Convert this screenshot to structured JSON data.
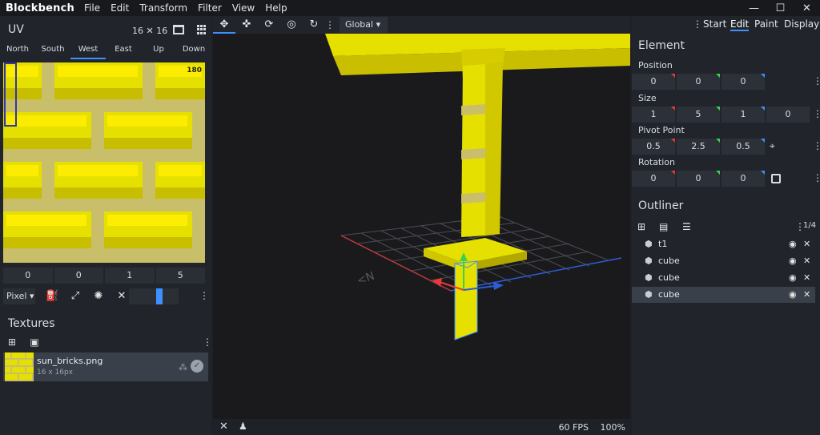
{
  "titlebar": {
    "app_name": "Blockbench",
    "menu": [
      "File",
      "Edit",
      "Transform",
      "Filter",
      "View",
      "Help"
    ],
    "window_controls": [
      "minimize-icon",
      "maximize-icon",
      "close-icon"
    ]
  },
  "uv": {
    "title": "UV",
    "size": "16 ✕ 16",
    "faces": [
      "North",
      "South",
      "West",
      "East",
      "Up",
      "Down"
    ],
    "active_face": "West",
    "rotation": "180",
    "values": [
      "0",
      "0",
      "1",
      "5"
    ],
    "toolbar": {
      "mode": "Pixel"
    }
  },
  "textures": {
    "title": "Textures",
    "items": [
      {
        "name": "sun_bricks.png",
        "dims": "16 x 16px"
      }
    ]
  },
  "viewport": {
    "transform_space": "Global",
    "fps": "60 FPS",
    "zoom": "100%"
  },
  "modes": [
    "Start",
    "Edit",
    "Paint",
    "Display"
  ],
  "active_mode": "Edit",
  "element": {
    "title": "Element",
    "position": {
      "label": "Position",
      "values": [
        "0",
        "0",
        "0"
      ]
    },
    "size": {
      "label": "Size",
      "values": [
        "1",
        "5",
        "1",
        "0"
      ]
    },
    "pivot": {
      "label": "Pivot Point",
      "values": [
        "0.5",
        "2.5",
        "0.5"
      ]
    },
    "rotation": {
      "label": "Rotation",
      "values": [
        "0",
        "0",
        "0"
      ]
    }
  },
  "outliner": {
    "title": "Outliner",
    "count": "1/4",
    "items": [
      {
        "label": "t1",
        "selected": false
      },
      {
        "label": "cube",
        "selected": false
      },
      {
        "label": "cube",
        "selected": false
      },
      {
        "label": "cube",
        "selected": true
      }
    ]
  },
  "colors": {
    "accent": "#3e90ff",
    "texture_yellow": "#e6e000",
    "mortar": "#c9bf6a"
  }
}
